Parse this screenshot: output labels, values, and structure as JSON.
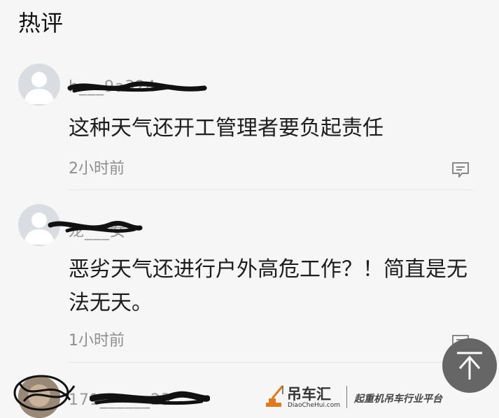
{
  "section_title": "热评",
  "comments": [
    {
      "username": "h___9a324",
      "content": "这种天气还开工管理者要负起责任",
      "time": "2小时前",
      "reply_icon": "comment-icon"
    },
    {
      "username": "龙___女",
      "content": "恶劣天气还进行户外高危工作？！简直是无法无天。",
      "time": "1小时前",
      "reply_icon": "comment-icon"
    },
    {
      "username": "171______23",
      "content": "",
      "time": ""
    }
  ],
  "back_to_top_icon": "arrow-up-icon",
  "watermark": {
    "brand": "吊车汇",
    "url": "DiaoCheHui.com",
    "slogan": "起重机吊车行业平台",
    "logo_icon": "crane-icon"
  },
  "colors": {
    "background": "#f6f6f6",
    "text": "#1d1d1d",
    "meta": "#8e8e8e",
    "back_to_top": "#666666",
    "accent_logo": "#e07a1f"
  }
}
